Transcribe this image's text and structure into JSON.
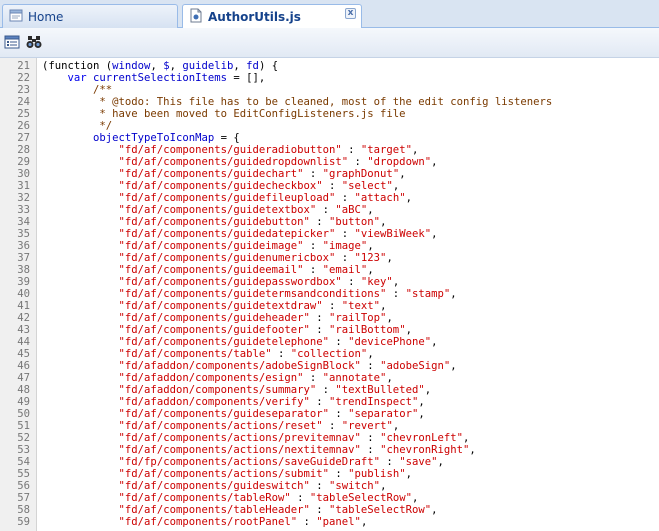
{
  "tabs": {
    "home_label": "Home",
    "active_label": "AuthorUtils.js",
    "close_glyph": "x"
  },
  "toolbar": {
    "outline_icon": "outline-view-icon",
    "find_icon": "binoculars-find-icon"
  },
  "code": {
    "intro": [
      {
        "n": "21",
        "indent": "",
        "parts": [
          [
            "p",
            "(function ("
          ],
          [
            "id",
            "window"
          ],
          [
            "p",
            ", "
          ],
          [
            "id",
            "$"
          ],
          [
            "p",
            ", "
          ],
          [
            "id",
            "guidelib"
          ],
          [
            "p",
            ", "
          ],
          [
            "id",
            "fd"
          ],
          [
            "p",
            ") {"
          ]
        ]
      },
      {
        "n": "22",
        "indent": "    ",
        "parts": [
          [
            "kw",
            "var "
          ],
          [
            "id",
            "currentSelectionItems"
          ],
          [
            "p",
            " = [],"
          ]
        ]
      },
      {
        "n": "23",
        "indent": "        ",
        "parts": [
          [
            "cm",
            "/**"
          ]
        ]
      },
      {
        "n": "24",
        "indent": "         ",
        "parts": [
          [
            "cm",
            "* @todo: This file has to be cleaned, most of the edit config listeners"
          ]
        ]
      },
      {
        "n": "25",
        "indent": "         ",
        "parts": [
          [
            "cm",
            "* have been moved to EditConfigListeners.js file"
          ]
        ]
      },
      {
        "n": "26",
        "indent": "         ",
        "parts": [
          [
            "cm",
            "*/"
          ]
        ]
      },
      {
        "n": "27",
        "indent": "        ",
        "parts": [
          [
            "id",
            "objectTypeToIconMap"
          ],
          [
            "p",
            " = {"
          ]
        ]
      }
    ],
    "map_entries": [
      {
        "n": "28",
        "key": "\"fd/af/components/guideradiobutton\"",
        "value": "\"target\""
      },
      {
        "n": "29",
        "key": "\"fd/af/components/guidedropdownlist\"",
        "value": "\"dropdown\""
      },
      {
        "n": "30",
        "key": "\"fd/af/components/guidechart\"",
        "value": "\"graphDonut\""
      },
      {
        "n": "31",
        "key": "\"fd/af/components/guidecheckbox\"",
        "value": "\"select\""
      },
      {
        "n": "32",
        "key": "\"fd/af/components/guidefileupload\"",
        "value": "\"attach\""
      },
      {
        "n": "33",
        "key": "\"fd/af/components/guidetextbox\"",
        "value": "\"aBC\""
      },
      {
        "n": "34",
        "key": "\"fd/af/components/guidebutton\"",
        "value": "\"button\""
      },
      {
        "n": "35",
        "key": "\"fd/af/components/guidedatepicker\"",
        "value": "\"viewBiWeek\""
      },
      {
        "n": "36",
        "key": "\"fd/af/components/guideimage\"",
        "value": "\"image\""
      },
      {
        "n": "37",
        "key": "\"fd/af/components/guidenumericbox\"",
        "value": "\"123\""
      },
      {
        "n": "38",
        "key": "\"fd/af/components/guideemail\"",
        "value": "\"email\""
      },
      {
        "n": "39",
        "key": "\"fd/af/components/guidepasswordbox\"",
        "value": "\"key\""
      },
      {
        "n": "40",
        "key": "\"fd/af/components/guidetermsandconditions\"",
        "value": "\"stamp\""
      },
      {
        "n": "41",
        "key": "\"fd/af/components/guidetextdraw\"",
        "value": "\"text\""
      },
      {
        "n": "42",
        "key": "\"fd/af/components/guideheader\"",
        "value": "\"railTop\""
      },
      {
        "n": "43",
        "key": "\"fd/af/components/guidefooter\"",
        "value": "\"railBottom\""
      },
      {
        "n": "44",
        "key": "\"fd/af/components/guidetelephone\"",
        "value": "\"devicePhone\""
      },
      {
        "n": "45",
        "key": "\"fd/af/components/table\"",
        "value": "\"collection\""
      },
      {
        "n": "46",
        "key": "\"fd/afaddon/components/adobeSignBlock\"",
        "value": "\"adobeSign\""
      },
      {
        "n": "47",
        "key": "\"fd/afaddon/components/esign\"",
        "value": "\"annotate\""
      },
      {
        "n": "48",
        "key": "\"fd/afaddon/components/summary\"",
        "value": "\"textBulleted\""
      },
      {
        "n": "49",
        "key": "\"fd/afaddon/components/verify\"",
        "value": "\"trendInspect\""
      },
      {
        "n": "50",
        "key": "\"fd/af/components/guideseparator\"",
        "value": "\"separator\""
      },
      {
        "n": "51",
        "key": "\"fd/af/components/actions/reset\"",
        "value": "\"revert\""
      },
      {
        "n": "52",
        "key": "\"fd/af/components/actions/previtemnav\"",
        "value": "\"chevronLeft\""
      },
      {
        "n": "53",
        "key": "\"fd/af/components/actions/nextitemnav\"",
        "value": "\"chevronRight\""
      },
      {
        "n": "54",
        "key": "\"fd/fp/components/actions/saveGuideDraft\"",
        "value": "\"save\""
      },
      {
        "n": "55",
        "key": "\"fd/af/components/actions/submit\"",
        "value": "\"publish\""
      },
      {
        "n": "56",
        "key": "\"fd/af/components/guideswitch\"",
        "value": "\"switch\""
      },
      {
        "n": "57",
        "key": "\"fd/af/components/tableRow\"",
        "value": "\"tableSelectRow\""
      },
      {
        "n": "58",
        "key": "\"fd/af/components/tableHeader\"",
        "value": "\"tableSelectRow\""
      },
      {
        "n": "59",
        "key": "\"fd/af/components/rootPanel\"",
        "value": "\"panel\""
      }
    ]
  }
}
